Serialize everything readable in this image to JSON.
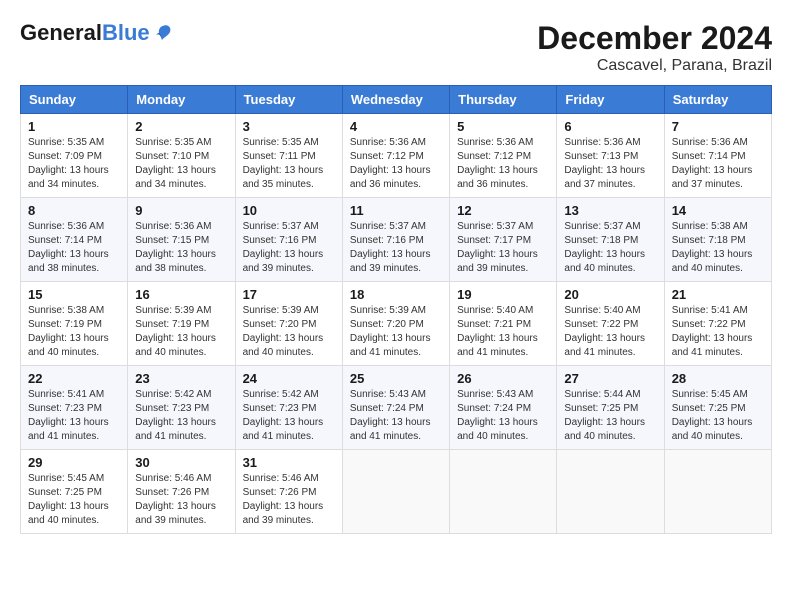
{
  "header": {
    "logo_general": "General",
    "logo_blue": "Blue",
    "title": "December 2024",
    "subtitle": "Cascavel, Parana, Brazil"
  },
  "columns": [
    "Sunday",
    "Monday",
    "Tuesday",
    "Wednesday",
    "Thursday",
    "Friday",
    "Saturday"
  ],
  "weeks": [
    [
      {
        "day": "1",
        "sunrise": "5:35 AM",
        "sunset": "7:09 PM",
        "daylight": "13 hours and 34 minutes."
      },
      {
        "day": "2",
        "sunrise": "5:35 AM",
        "sunset": "7:10 PM",
        "daylight": "13 hours and 34 minutes."
      },
      {
        "day": "3",
        "sunrise": "5:35 AM",
        "sunset": "7:11 PM",
        "daylight": "13 hours and 35 minutes."
      },
      {
        "day": "4",
        "sunrise": "5:36 AM",
        "sunset": "7:12 PM",
        "daylight": "13 hours and 36 minutes."
      },
      {
        "day": "5",
        "sunrise": "5:36 AM",
        "sunset": "7:12 PM",
        "daylight": "13 hours and 36 minutes."
      },
      {
        "day": "6",
        "sunrise": "5:36 AM",
        "sunset": "7:13 PM",
        "daylight": "13 hours and 37 minutes."
      },
      {
        "day": "7",
        "sunrise": "5:36 AM",
        "sunset": "7:14 PM",
        "daylight": "13 hours and 37 minutes."
      }
    ],
    [
      {
        "day": "8",
        "sunrise": "5:36 AM",
        "sunset": "7:14 PM",
        "daylight": "13 hours and 38 minutes."
      },
      {
        "day": "9",
        "sunrise": "5:36 AM",
        "sunset": "7:15 PM",
        "daylight": "13 hours and 38 minutes."
      },
      {
        "day": "10",
        "sunrise": "5:37 AM",
        "sunset": "7:16 PM",
        "daylight": "13 hours and 39 minutes."
      },
      {
        "day": "11",
        "sunrise": "5:37 AM",
        "sunset": "7:16 PM",
        "daylight": "13 hours and 39 minutes."
      },
      {
        "day": "12",
        "sunrise": "5:37 AM",
        "sunset": "7:17 PM",
        "daylight": "13 hours and 39 minutes."
      },
      {
        "day": "13",
        "sunrise": "5:37 AM",
        "sunset": "7:18 PM",
        "daylight": "13 hours and 40 minutes."
      },
      {
        "day": "14",
        "sunrise": "5:38 AM",
        "sunset": "7:18 PM",
        "daylight": "13 hours and 40 minutes."
      }
    ],
    [
      {
        "day": "15",
        "sunrise": "5:38 AM",
        "sunset": "7:19 PM",
        "daylight": "13 hours and 40 minutes."
      },
      {
        "day": "16",
        "sunrise": "5:39 AM",
        "sunset": "7:19 PM",
        "daylight": "13 hours and 40 minutes."
      },
      {
        "day": "17",
        "sunrise": "5:39 AM",
        "sunset": "7:20 PM",
        "daylight": "13 hours and 40 minutes."
      },
      {
        "day": "18",
        "sunrise": "5:39 AM",
        "sunset": "7:20 PM",
        "daylight": "13 hours and 41 minutes."
      },
      {
        "day": "19",
        "sunrise": "5:40 AM",
        "sunset": "7:21 PM",
        "daylight": "13 hours and 41 minutes."
      },
      {
        "day": "20",
        "sunrise": "5:40 AM",
        "sunset": "7:22 PM",
        "daylight": "13 hours and 41 minutes."
      },
      {
        "day": "21",
        "sunrise": "5:41 AM",
        "sunset": "7:22 PM",
        "daylight": "13 hours and 41 minutes."
      }
    ],
    [
      {
        "day": "22",
        "sunrise": "5:41 AM",
        "sunset": "7:23 PM",
        "daylight": "13 hours and 41 minutes."
      },
      {
        "day": "23",
        "sunrise": "5:42 AM",
        "sunset": "7:23 PM",
        "daylight": "13 hours and 41 minutes."
      },
      {
        "day": "24",
        "sunrise": "5:42 AM",
        "sunset": "7:23 PM",
        "daylight": "13 hours and 41 minutes."
      },
      {
        "day": "25",
        "sunrise": "5:43 AM",
        "sunset": "7:24 PM",
        "daylight": "13 hours and 41 minutes."
      },
      {
        "day": "26",
        "sunrise": "5:43 AM",
        "sunset": "7:24 PM",
        "daylight": "13 hours and 40 minutes."
      },
      {
        "day": "27",
        "sunrise": "5:44 AM",
        "sunset": "7:25 PM",
        "daylight": "13 hours and 40 minutes."
      },
      {
        "day": "28",
        "sunrise": "5:45 AM",
        "sunset": "7:25 PM",
        "daylight": "13 hours and 40 minutes."
      }
    ],
    [
      {
        "day": "29",
        "sunrise": "5:45 AM",
        "sunset": "7:25 PM",
        "daylight": "13 hours and 40 minutes."
      },
      {
        "day": "30",
        "sunrise": "5:46 AM",
        "sunset": "7:26 PM",
        "daylight": "13 hours and 39 minutes."
      },
      {
        "day": "31",
        "sunrise": "5:46 AM",
        "sunset": "7:26 PM",
        "daylight": "13 hours and 39 minutes."
      },
      null,
      null,
      null,
      null
    ]
  ]
}
